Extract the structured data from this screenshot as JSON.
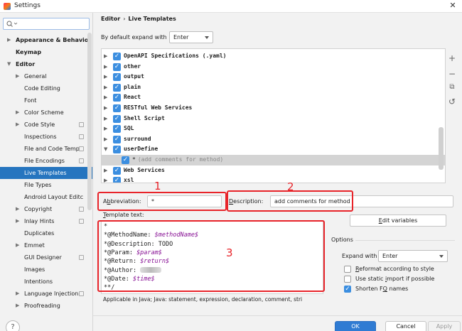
{
  "window": {
    "title": "Settings",
    "close": "✕"
  },
  "search": {
    "placeholder": ""
  },
  "sidebar": {
    "items": [
      {
        "label": "Appearance & Behavior",
        "bold": true,
        "arrow": "▶",
        "indent": 0
      },
      {
        "label": "Keymap",
        "bold": true,
        "arrow": "",
        "indent": 0
      },
      {
        "label": "Editor",
        "bold": true,
        "arrow": "▼",
        "indent": 0
      },
      {
        "label": "General",
        "arrow": "▶",
        "indent": 1
      },
      {
        "label": "Code Editing",
        "arrow": "",
        "indent": 1
      },
      {
        "label": "Font",
        "arrow": "",
        "indent": 1
      },
      {
        "label": "Color Scheme",
        "arrow": "▶",
        "indent": 1
      },
      {
        "label": "Code Style",
        "arrow": "▶",
        "indent": 1,
        "copy": true
      },
      {
        "label": "Inspections",
        "arrow": "",
        "indent": 1,
        "copy": true
      },
      {
        "label": "File and Code Temp",
        "arrow": "",
        "indent": 1,
        "copy": true
      },
      {
        "label": "File Encodings",
        "arrow": "",
        "indent": 1,
        "copy": true
      },
      {
        "label": "Live Templates",
        "arrow": "",
        "indent": 1,
        "selected": true
      },
      {
        "label": "File Types",
        "arrow": "",
        "indent": 1
      },
      {
        "label": "Android Layout Editc",
        "arrow": "",
        "indent": 1
      },
      {
        "label": "Copyright",
        "arrow": "▶",
        "indent": 1,
        "copy": true
      },
      {
        "label": "Inlay Hints",
        "arrow": "▶",
        "indent": 1,
        "copy": true
      },
      {
        "label": "Duplicates",
        "arrow": "",
        "indent": 1
      },
      {
        "label": "Emmet",
        "arrow": "▶",
        "indent": 1
      },
      {
        "label": "GUI Designer",
        "arrow": "",
        "indent": 1,
        "copy": true
      },
      {
        "label": "Images",
        "arrow": "",
        "indent": 1
      },
      {
        "label": "Intentions",
        "arrow": "",
        "indent": 1
      },
      {
        "label": "Language Injection",
        "arrow": "▶",
        "indent": 1,
        "copy": true
      },
      {
        "label": "Proofreading",
        "arrow": "▶",
        "indent": 1
      }
    ]
  },
  "breadcrumb": {
    "parent": "Editor",
    "separator": "›",
    "current": "Live Templates"
  },
  "expand": {
    "label": "By default expand with",
    "value": "Enter"
  },
  "tree": {
    "rows": [
      {
        "label": "OpenAPI Specifications (.yaml)",
        "arrow": "▶"
      },
      {
        "label": "other",
        "arrow": "▶"
      },
      {
        "label": "output",
        "arrow": "▶"
      },
      {
        "label": "plain",
        "arrow": "▶"
      },
      {
        "label": "React",
        "arrow": "▶"
      },
      {
        "label": "RESTful Web Services",
        "arrow": "▶"
      },
      {
        "label": "Shell Script",
        "arrow": "▶"
      },
      {
        "label": "SQL",
        "arrow": "▶"
      },
      {
        "label": "surround",
        "arrow": "▶"
      },
      {
        "label": "userDefine",
        "arrow": "▼"
      },
      {
        "label": "*",
        "desc": "(add comments for method)",
        "child": true,
        "highlight": true
      },
      {
        "label": "Web Services",
        "arrow": "▶"
      },
      {
        "label": "xsl",
        "arrow": "▶"
      }
    ]
  },
  "toolbar": {
    "add": "+",
    "remove": "−",
    "copy": "⧉",
    "restore": "↺"
  },
  "abbreviation": {
    "label_prefix": "A",
    "label_underlined": "b",
    "label_suffix": "breviation:",
    "value": "*"
  },
  "description": {
    "label_prefix": "",
    "label_underlined": "D",
    "label_suffix": "escription:",
    "value": "add comments for method"
  },
  "annotations": {
    "n1": "1",
    "n2": "2",
    "n3": "3"
  },
  "template": {
    "label_underlined": "T",
    "label_suffix": "emplate text:",
    "lines": [
      {
        "text": "*",
        "var": ""
      },
      {
        "text": "*@MethodName: ",
        "var": "$methodName$"
      },
      {
        "text": "*@Description: TODO",
        "var": ""
      },
      {
        "text": "*@Param: ",
        "var": "$param$"
      },
      {
        "text": "*@Return: ",
        "var": "$return$"
      },
      {
        "text": "*@Author: ",
        "var": "",
        "blur": true
      },
      {
        "text": "*@Date: ",
        "var": "$time$"
      },
      {
        "text": "**/",
        "var": ""
      }
    ]
  },
  "applicable": "Applicable in Java; Java: statement, expression, declaration, comment, stri",
  "edit_variables": {
    "underlined": "E",
    "suffix": "dit variables"
  },
  "options": {
    "title": "Options",
    "expand_with_label": "Expand with",
    "expand_with_value": "Enter",
    "checkboxes": [
      {
        "prefix": "",
        "underlined": "R",
        "suffix": "eformat according to style",
        "checked": false
      },
      {
        "prefix": "Use static ",
        "underlined": "i",
        "suffix": "mport if possible",
        "checked": false
      },
      {
        "prefix": "Shorten F",
        "underlined": "Q",
        "suffix": " names",
        "checked": true
      }
    ]
  },
  "buttons": {
    "ok": "OK",
    "cancel": "Cancel",
    "apply": "Apply",
    "help": "?"
  },
  "colors": {
    "accent": "#2675bf",
    "checkbox": "#3b8ee0",
    "annotation_red": "#e8242a",
    "ok_button": "#2f7bd3"
  }
}
